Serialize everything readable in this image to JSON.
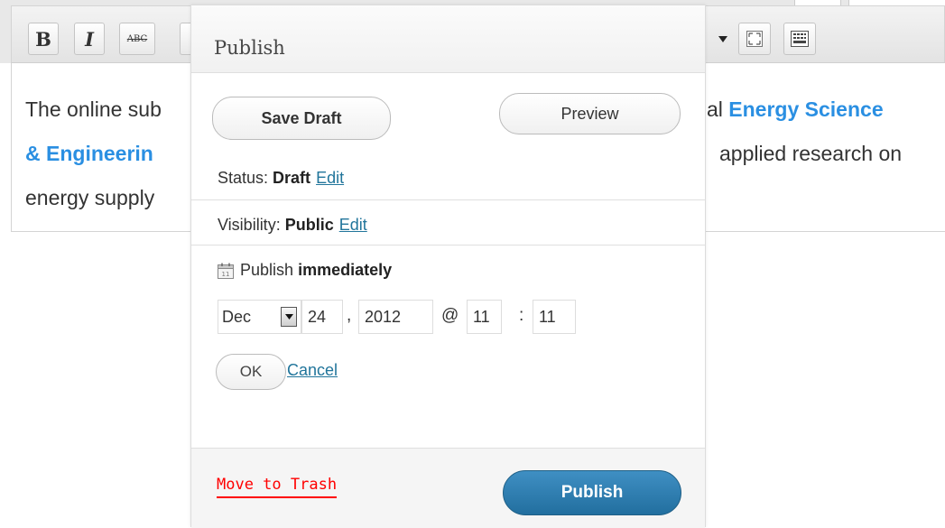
{
  "editor": {
    "toolbar": {
      "bold_label": "B",
      "italic_label": "I",
      "strike_label": "ABC",
      "dropdown_icon": "chevron-down-icon",
      "fullscreen_icon": "fullscreen-icon",
      "kitchen_sink_icon": "kitchen-sink-icon"
    },
    "content": {
      "line1_text": "The online sub",
      "line1_tail_text": "al ",
      "line1_link": "Energy Science",
      "line2_link": "& Engineerin",
      "line2_tail_text": "applied research on",
      "line3_text": "energy supply"
    }
  },
  "publish": {
    "title": "Publish",
    "save_draft_label": "Save Draft",
    "preview_label": "Preview",
    "status_label": "Status:",
    "status_value": "Draft",
    "status_edit": "Edit",
    "visibility_label": "Visibility:",
    "visibility_value": "Public",
    "visibility_edit": "Edit",
    "schedule_label": "Publish",
    "schedule_value": "immediately",
    "calendar_icon": "calendar-icon",
    "date": {
      "month": "Dec",
      "day": "24",
      "year": "2012",
      "hour": "11",
      "minute": "11",
      "comma": ",",
      "at": "@",
      "colon": ":"
    },
    "ok_label": "OK",
    "cancel_label": "Cancel",
    "trash_label": "Move to Trash",
    "publish_label": "Publish",
    "colors": {
      "publish_button": "#2a7aa8",
      "trash_link": "#ff0000",
      "edit_link": "#21759b",
      "editor_link": "#2a8fe2"
    }
  }
}
